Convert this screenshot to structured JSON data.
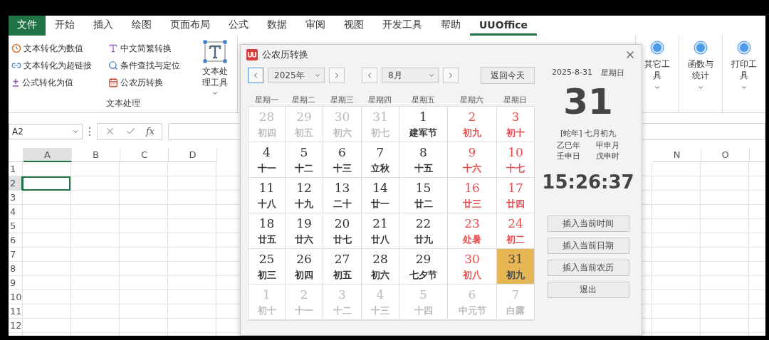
{
  "tabs": [
    {
      "label": "文件",
      "selected": false,
      "kind": "file"
    },
    {
      "label": "开始",
      "selected": false,
      "kind": "tab"
    },
    {
      "label": "插入",
      "selected": false,
      "kind": "tab"
    },
    {
      "label": "绘图",
      "selected": false,
      "kind": "tab"
    },
    {
      "label": "页面布局",
      "selected": false,
      "kind": "tab"
    },
    {
      "label": "公式",
      "selected": false,
      "kind": "tab"
    },
    {
      "label": "数据",
      "selected": false,
      "kind": "tab"
    },
    {
      "label": "审阅",
      "selected": false,
      "kind": "tab"
    },
    {
      "label": "视图",
      "selected": false,
      "kind": "tab"
    },
    {
      "label": "开发工具",
      "selected": false,
      "kind": "tab"
    },
    {
      "label": "帮助",
      "selected": false,
      "kind": "tab"
    },
    {
      "label": "UUOffice",
      "selected": true,
      "kind": "tab"
    }
  ],
  "ribbon": {
    "text_group": {
      "label": "文本处理",
      "items": [
        "文本转化为数值",
        "中文简繁转换",
        "文本转化为超链接",
        "条件查找与定位",
        "公式转化为值",
        "公农历转换"
      ],
      "large_button": "文本处理工具"
    },
    "tool_buttons": [
      "其它工具",
      "函数与统计",
      "打印工具"
    ]
  },
  "formula_bar": {
    "name_box": "A2",
    "fx": "fx"
  },
  "sheet": {
    "columns_left": [
      {
        "label": "A",
        "selected": true
      },
      {
        "label": "B",
        "selected": false
      },
      {
        "label": "C",
        "selected": false
      },
      {
        "label": "D",
        "selected": false
      }
    ],
    "columns_right": [
      {
        "label": "N",
        "selected": false
      },
      {
        "label": "O",
        "selected": false
      }
    ],
    "rows": [
      {
        "label": "1",
        "selected": false
      },
      {
        "label": "2",
        "selected": true
      },
      {
        "label": "3",
        "selected": false
      },
      {
        "label": "4",
        "selected": false
      },
      {
        "label": "5",
        "selected": false
      },
      {
        "label": "6",
        "selected": false
      },
      {
        "label": "7",
        "selected": false
      },
      {
        "label": "8",
        "selected": false
      },
      {
        "label": "9",
        "selected": false
      },
      {
        "label": "10",
        "selected": false
      },
      {
        "label": "11",
        "selected": false
      },
      {
        "label": "12",
        "selected": false
      }
    ]
  },
  "dialog": {
    "title": "公农历转换",
    "year": "2025年",
    "month": "8月",
    "today_button": "返回今天",
    "weekdays": [
      "星期一",
      "星期二",
      "星期三",
      "星期四",
      "星期五",
      "星期六",
      "星期日"
    ],
    "days": [
      {
        "day": "28",
        "lunar": "初四",
        "in_month": false,
        "selected": false
      },
      {
        "day": "29",
        "lunar": "初五",
        "in_month": false,
        "selected": false
      },
      {
        "day": "30",
        "lunar": "初六",
        "in_month": false,
        "selected": false
      },
      {
        "day": "31",
        "lunar": "初七",
        "in_month": false,
        "selected": false
      },
      {
        "day": "1",
        "lunar": "建军节",
        "in_month": true,
        "selected": false
      },
      {
        "day": "2",
        "lunar": "初九",
        "in_month": true,
        "selected": false
      },
      {
        "day": "3",
        "lunar": "初十",
        "in_month": true,
        "selected": false
      },
      {
        "day": "4",
        "lunar": "十一",
        "in_month": true,
        "selected": false
      },
      {
        "day": "5",
        "lunar": "十二",
        "in_month": true,
        "selected": false
      },
      {
        "day": "6",
        "lunar": "十三",
        "in_month": true,
        "selected": false
      },
      {
        "day": "7",
        "lunar": "立秋",
        "in_month": true,
        "selected": false
      },
      {
        "day": "8",
        "lunar": "十五",
        "in_month": true,
        "selected": false
      },
      {
        "day": "9",
        "lunar": "十六",
        "in_month": true,
        "selected": false
      },
      {
        "day": "10",
        "lunar": "十七",
        "in_month": true,
        "selected": false
      },
      {
        "day": "11",
        "lunar": "十八",
        "in_month": true,
        "selected": false
      },
      {
        "day": "12",
        "lunar": "十九",
        "in_month": true,
        "selected": false
      },
      {
        "day": "13",
        "lunar": "二十",
        "in_month": true,
        "selected": false
      },
      {
        "day": "14",
        "lunar": "廿一",
        "in_month": true,
        "selected": false
      },
      {
        "day": "15",
        "lunar": "廿二",
        "in_month": true,
        "selected": false
      },
      {
        "day": "16",
        "lunar": "廿三",
        "in_month": true,
        "selected": false
      },
      {
        "day": "17",
        "lunar": "廿四",
        "in_month": true,
        "selected": false
      },
      {
        "day": "18",
        "lunar": "廿五",
        "in_month": true,
        "selected": false
      },
      {
        "day": "19",
        "lunar": "廿六",
        "in_month": true,
        "selected": false
      },
      {
        "day": "20",
        "lunar": "廿七",
        "in_month": true,
        "selected": false
      },
      {
        "day": "21",
        "lunar": "廿八",
        "in_month": true,
        "selected": false
      },
      {
        "day": "22",
        "lunar": "廿九",
        "in_month": true,
        "selected": false
      },
      {
        "day": "23",
        "lunar": "处暑",
        "in_month": true,
        "selected": false
      },
      {
        "day": "24",
        "lunar": "初二",
        "in_month": true,
        "selected": false
      },
      {
        "day": "25",
        "lunar": "初三",
        "in_month": true,
        "selected": false
      },
      {
        "day": "26",
        "lunar": "初四",
        "in_month": true,
        "selected": false
      },
      {
        "day": "27",
        "lunar": "初五",
        "in_month": true,
        "selected": false
      },
      {
        "day": "28",
        "lunar": "初六",
        "in_month": true,
        "selected": false
      },
      {
        "day": "29",
        "lunar": "七夕节",
        "in_month": true,
        "selected": false
      },
      {
        "day": "30",
        "lunar": "初八",
        "in_month": true,
        "selected": false
      },
      {
        "day": "31",
        "lunar": "初九",
        "in_month": true,
        "selected": true
      },
      {
        "day": "1",
        "lunar": "初十",
        "in_month": false,
        "selected": false
      },
      {
        "day": "2",
        "lunar": "十一",
        "in_month": false,
        "selected": false
      },
      {
        "day": "3",
        "lunar": "十二",
        "in_month": false,
        "selected": false
      },
      {
        "day": "4",
        "lunar": "十三",
        "in_month": false,
        "selected": false
      },
      {
        "day": "5",
        "lunar": "十四",
        "in_month": false,
        "selected": false
      },
      {
        "day": "6",
        "lunar": "中元节",
        "in_month": false,
        "selected": false
      },
      {
        "day": "7",
        "lunar": "白露",
        "in_month": false,
        "selected": false
      }
    ],
    "date_line": "2025-8-31",
    "weekday": "星期日",
    "big_day": "31",
    "lunar_date": "[蛇年] 七月初九",
    "ganzhi": [
      "乙巳年",
      "甲申月",
      "壬申日",
      "戊申时"
    ],
    "time": "15:26:37",
    "buttons": [
      "插入当前时间",
      "插入当前日期",
      "插入当前农历",
      "退出"
    ]
  }
}
